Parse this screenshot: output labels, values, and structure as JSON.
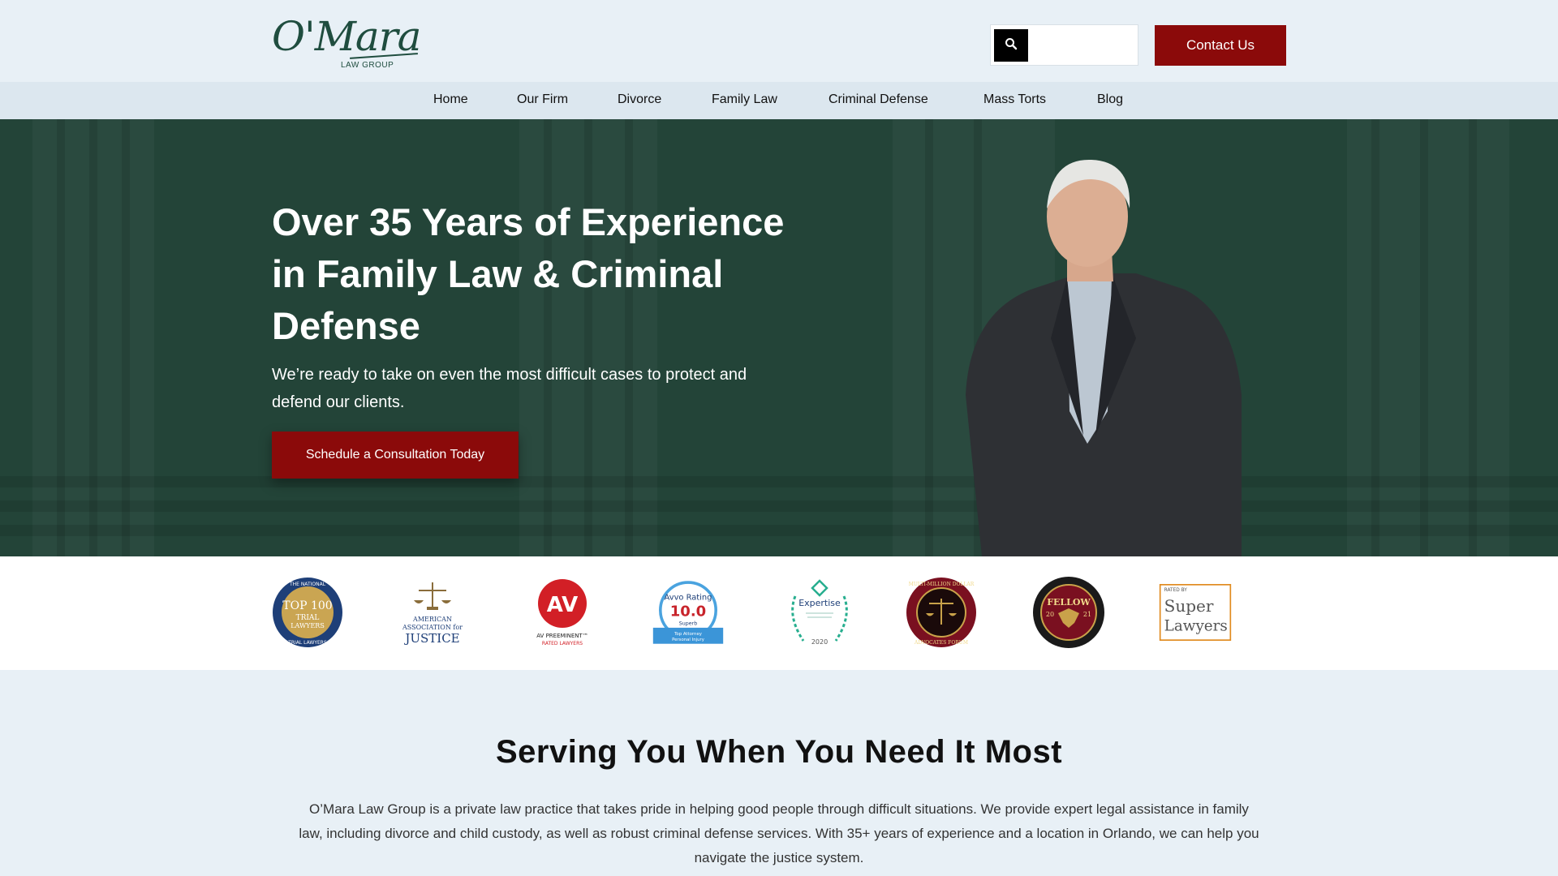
{
  "header": {
    "logo_main": "O'Mara",
    "logo_sub": "LAW GROUP",
    "search_placeholder": "",
    "contact_label": "Contact Us"
  },
  "nav": {
    "items": [
      "Home",
      "Our Firm",
      "Divorce",
      "Family Law",
      "Criminal Defense",
      "Mass Torts",
      "Blog"
    ]
  },
  "hero": {
    "title": "Over 35 Years of Experience in Family Law & Criminal Defense",
    "subtitle": "We’re ready to take on even the most difficult cases to protect and defend our clients.",
    "cta_label": "Schedule a Consultation Today"
  },
  "badges": [
    {
      "name": "national-trial-lawyers-top100",
      "lines": [
        "THE NATIONAL",
        "TOP 100",
        "TRIAL",
        "LAWYERS",
        "TRIAL LAWYERS"
      ]
    },
    {
      "name": "american-association-for-justice",
      "lines": [
        "AMERICAN",
        "ASSOCIATION for",
        "JUSTICE"
      ]
    },
    {
      "name": "av-preeminent",
      "lines": [
        "AV",
        "AV PREEMINENT™",
        "RATED LAWYERS"
      ]
    },
    {
      "name": "avvo-rating",
      "lines": [
        "Avvo Rating",
        "10.0",
        "Superb",
        "Top Attorney",
        "Personal Injury"
      ]
    },
    {
      "name": "expertise-2020",
      "lines": [
        "Expertise",
        "2020"
      ]
    },
    {
      "name": "multi-million-dollar-advocates",
      "lines": [
        "MULTI-MILLION DOLLAR",
        "ADVOCATES FORUM"
      ]
    },
    {
      "name": "fellow-2021",
      "lines": [
        "FELLOW",
        "20",
        "21"
      ]
    },
    {
      "name": "super-lawyers",
      "lines": [
        "RATED BY",
        "Super",
        "Lawyers"
      ]
    }
  ],
  "serving": {
    "title": "Serving You When You Need It Most",
    "text": "O’Mara Law Group is a private law practice that takes pride in helping good people through difficult situations. We provide expert legal assistance in family law, including divorce and child custody, as well as robust criminal defense services. With 35+ years of experience and a location in Orlando, we can help you navigate the justice system."
  },
  "colors": {
    "brand_green": "#234438",
    "accent_red": "#8b0a0a",
    "background": "#e8f0f6"
  },
  "icons": {
    "search": "search-icon"
  }
}
